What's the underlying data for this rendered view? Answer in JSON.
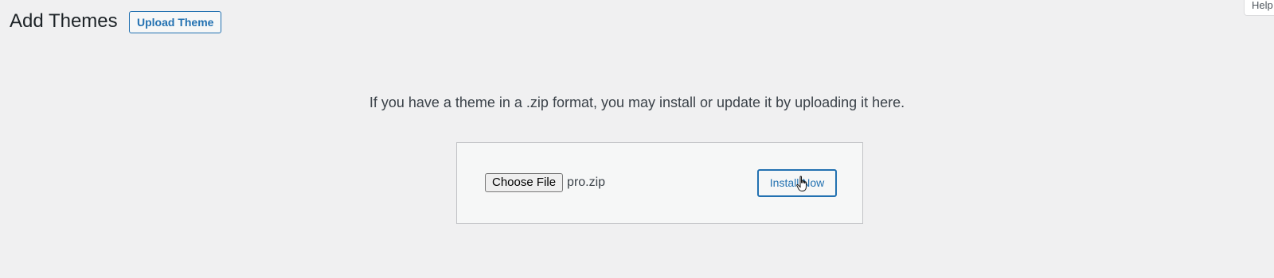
{
  "help_tab": {
    "label": "Help"
  },
  "header": {
    "title": "Add Themes",
    "upload_button_label": "Upload Theme"
  },
  "upload": {
    "help_text": "If you have a theme in a .zip format, you may install or update it by uploading it here.",
    "choose_file_label": "Choose File",
    "file_name": "pro.zip",
    "install_button_label": "Install Now"
  },
  "icons": {
    "cursor": "hand-pointer-icon"
  },
  "colors": {
    "background": "#f0f0f1",
    "accent": "#2271b1",
    "box_background": "#f6f7f7",
    "box_border": "#c3c4c7"
  }
}
